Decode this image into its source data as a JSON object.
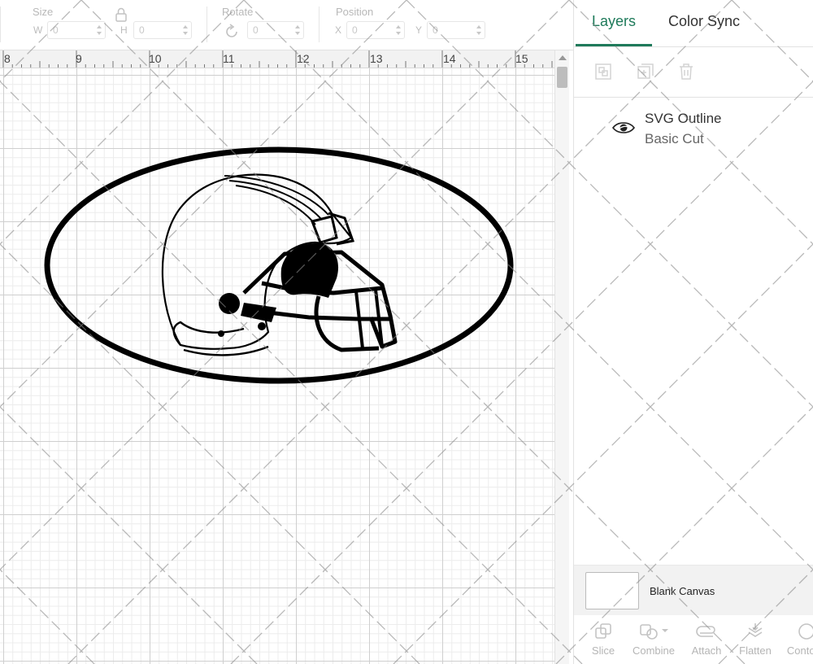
{
  "toolbar": {
    "size": {
      "label": "Size",
      "w_label": "W",
      "h_label": "H",
      "w_value": "0",
      "h_value": "0"
    },
    "rotate": {
      "label": "Rotate",
      "value": "0"
    },
    "position": {
      "label": "Position",
      "x_label": "X",
      "y_label": "Y",
      "x_value": "0",
      "y_value": "0"
    }
  },
  "ruler": {
    "labels": [
      "8",
      "9",
      "10",
      "11",
      "12",
      "13",
      "14",
      "15"
    ]
  },
  "canvas": {
    "design": "helmet-oval-outline-icon"
  },
  "panel": {
    "tabs": [
      {
        "label": "Layers",
        "active": true
      },
      {
        "label": "Color Sync",
        "active": false
      }
    ],
    "layer": {
      "name": "SVG Outline",
      "operation": "Basic Cut"
    },
    "canvas_label": "Blank Canvas",
    "actions": [
      "Slice",
      "Combine",
      "Attach",
      "Flatten",
      "Contour"
    ]
  },
  "colors": {
    "accent": "#1e7a5a",
    "ink": "#000000"
  }
}
